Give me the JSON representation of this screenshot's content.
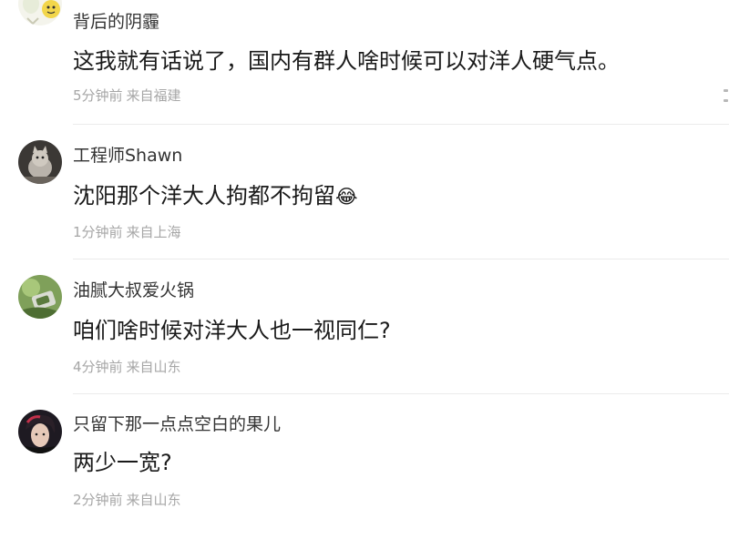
{
  "comments": [
    {
      "username": "背后的阴霾",
      "content": "这我就有话说了，国内有群人啥时候可以对洋人硬气点。",
      "time": "5分钟前",
      "location": "来自福建",
      "avatar_icon": "cartoon-lemon-avatar-icon"
    },
    {
      "username": "工程师Shawn",
      "content": "沈阳那个洋大人拘都不拘留",
      "emoji": "😂",
      "emoji_icon": "laughing-crying-emoji-icon",
      "time": "1分钟前",
      "location": "来自上海",
      "avatar_icon": "cat-photo-avatar-icon"
    },
    {
      "username": "油腻大叔爱火锅",
      "content": "咱们啥时候对洋大人也一视同仁?",
      "time": "4分钟前",
      "location": "来自山东",
      "avatar_icon": "green-photo-avatar-icon"
    },
    {
      "username": "只留下那一点点空白的果儿",
      "content": "两少一宽?",
      "time": "2分钟前",
      "location": "来自山东",
      "avatar_icon": "dark-hair-person-avatar-icon"
    }
  ],
  "colors": {
    "username": "#333333",
    "content": "#1a1a1a",
    "meta": "#a6a6a6",
    "divider": "#ebebeb"
  }
}
